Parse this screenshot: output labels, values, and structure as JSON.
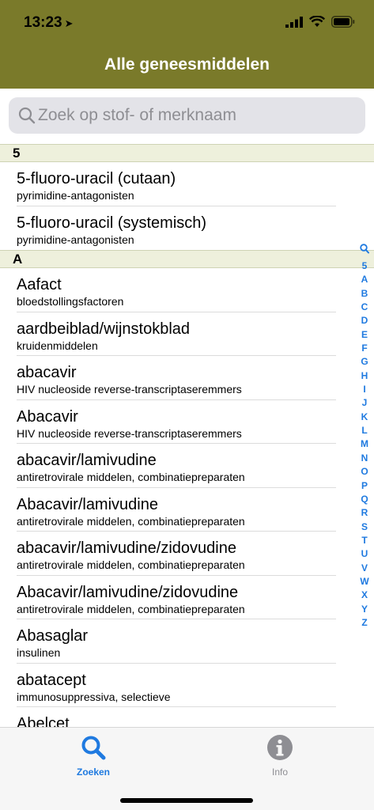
{
  "status_bar": {
    "time": "13:23",
    "location_glyph": "➤"
  },
  "header": {
    "title": "Alle geneesmiddelen"
  },
  "search": {
    "placeholder": "Zoek op stof- of merknaam"
  },
  "sections": [
    {
      "header": "5",
      "items": [
        {
          "name": "5-fluoro-uracil (cutaan)",
          "category": "pyrimidine-antagonisten"
        },
        {
          "name": "5-fluoro-uracil (systemisch)",
          "category": "pyrimidine-antagonisten"
        }
      ]
    },
    {
      "header": "A",
      "items": [
        {
          "name": "Aafact",
          "category": "bloedstollingsfactoren"
        },
        {
          "name": "aardbeiblad/wijnstokblad",
          "category": "kruidenmiddelen"
        },
        {
          "name": "abacavir",
          "category": "HIV nucleoside reverse-transcriptaseremmers"
        },
        {
          "name": "Abacavir",
          "category": "HIV nucleoside reverse-transcriptaseremmers"
        },
        {
          "name": "abacavir/lamivudine",
          "category": "antiretrovirale middelen, combinatiepreparaten"
        },
        {
          "name": "Abacavir/lamivudine",
          "category": "antiretrovirale middelen, combinatiepreparaten"
        },
        {
          "name": "abacavir/lamivudine/zidovudine",
          "category": "antiretrovirale middelen, combinatiepreparaten"
        },
        {
          "name": "Abacavir/lamivudine/zidovudine",
          "category": "antiretrovirale middelen, combinatiepreparaten"
        },
        {
          "name": "Abasaglar",
          "category": "insulinen"
        },
        {
          "name": "abatacept",
          "category": "immunosuppressiva, selectieve"
        },
        {
          "name": "Abelcet",
          "category": ""
        }
      ]
    }
  ],
  "index_letters": [
    "5",
    "A",
    "B",
    "C",
    "D",
    "E",
    "F",
    "G",
    "H",
    "I",
    "J",
    "K",
    "L",
    "M",
    "N",
    "O",
    "P",
    "Q",
    "R",
    "S",
    "T",
    "U",
    "V",
    "W",
    "X",
    "Y",
    "Z"
  ],
  "tabs": {
    "search_label": "Zoeken",
    "info_label": "Info"
  },
  "colors": {
    "header_bg": "#7a7a2a",
    "accent": "#1f7ae0",
    "section_bg": "#eef0dc"
  }
}
